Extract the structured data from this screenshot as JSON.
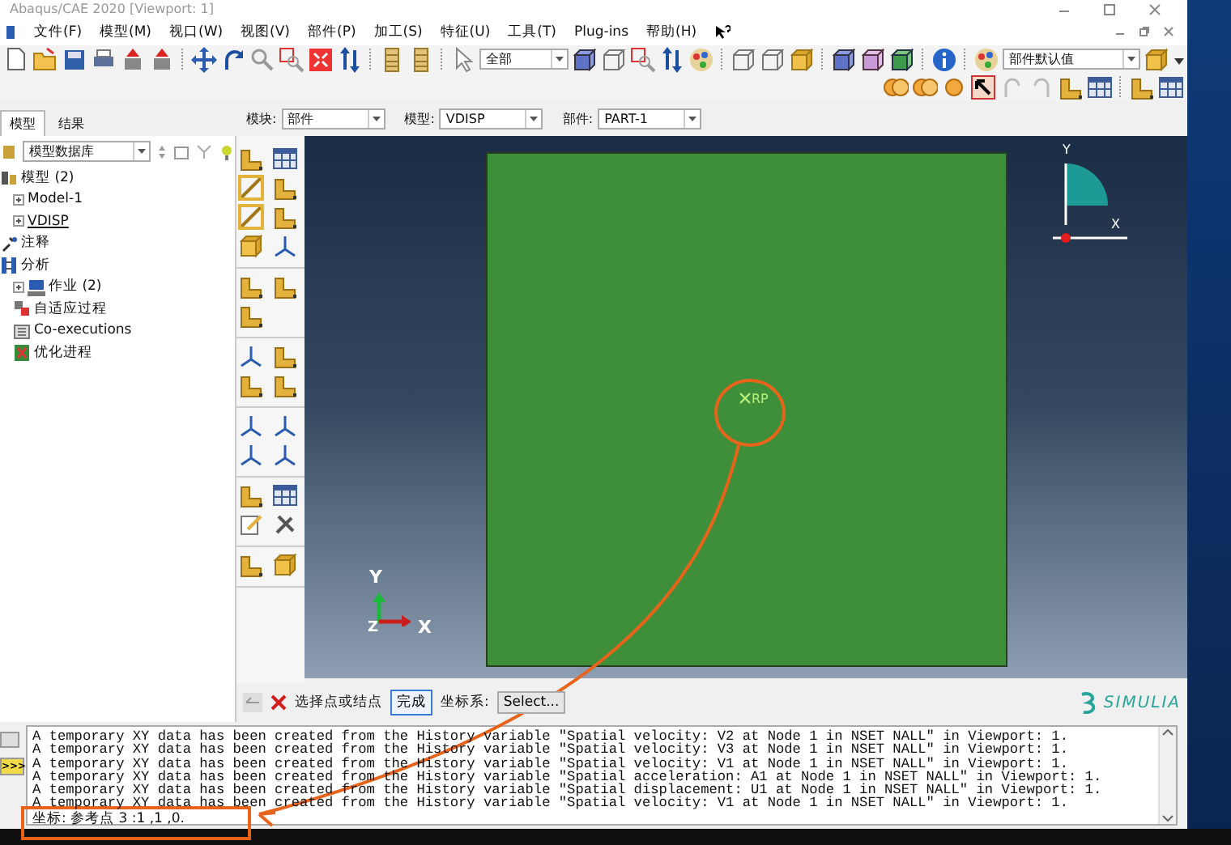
{
  "window": {
    "title": "Abaqus/CAE 2020 [Viewport: 1]"
  },
  "menu": [
    "文件(F)",
    "模型(M)",
    "视口(W)",
    "视图(V)",
    "部件(P)",
    "加工(S)",
    "特征(U)",
    "工具(T)",
    "Plug-ins",
    "帮助(H)"
  ],
  "toolbar": {
    "selection_filter": "全部",
    "part_defaults": "部件默认值"
  },
  "context_bar": [
    {
      "label": "模块:",
      "value": "部件"
    },
    {
      "label": "模型:",
      "value": "VDISP"
    },
    {
      "label": "部件:",
      "value": "PART-1"
    }
  ],
  "panel_tabs": [
    {
      "label": "模型",
      "selected": true
    },
    {
      "label": "结果",
      "selected": false
    }
  ],
  "tree": {
    "database": "模型数据库",
    "nodes": [
      {
        "label": "模型 (2)",
        "kind": "models",
        "collapsed": false,
        "current": false,
        "children": [
          {
            "label": "Model-1",
            "kind": "model",
            "collapsed": true,
            "current": false
          },
          {
            "label": "VDISP",
            "kind": "model",
            "collapsed": true,
            "current": true
          }
        ]
      },
      {
        "label": "注释",
        "kind": "annotations",
        "collapsed": false,
        "current": false
      },
      {
        "label": "分析",
        "kind": "analysis",
        "collapsed": false,
        "current": false,
        "children": [
          {
            "label": "作业 (2)",
            "kind": "jobs",
            "collapsed": true,
            "current": false
          },
          {
            "label": "自适应过程",
            "kind": "adaptivity",
            "collapsed": false,
            "current": false
          },
          {
            "label": "Co-executions",
            "kind": "coexec",
            "collapsed": false,
            "current": false
          },
          {
            "label": "优化进程",
            "kind": "optimization",
            "collapsed": false,
            "current": false
          }
        ]
      }
    ]
  },
  "viewport": {
    "point_label": "RP",
    "triad": {
      "y": "Y",
      "x": "X"
    },
    "axes": {
      "y": "Y",
      "z": "Z",
      "x": "X"
    }
  },
  "prompt": {
    "text": "选择点或结点",
    "done": "完成",
    "csys_label": "坐标系:",
    "csys_button": "Select..."
  },
  "brand": "SIMULIA",
  "command_toggle": ">>>",
  "messages": [
    "A temporary XY data has been created from the History variable \"Spatial velocity: V2 at Node 1 in NSET NALL\" in Viewport: 1.",
    "A temporary XY data has been created from the History variable \"Spatial velocity: V3 at Node 1 in NSET NALL\" in Viewport: 1.",
    "A temporary XY data has been created from the History variable \"Spatial velocity: V1 at Node 1 in NSET NALL\" in Viewport: 1.",
    "A temporary XY data has been created from the History variable \"Spatial acceleration: A1 at Node 1 in NSET NALL\" in Viewport: 1.",
    "A temporary XY data has been created from the History variable \"Spatial displacement: U1 at Node 1 in NSET NALL\" in Viewport: 1.",
    "A temporary XY data has been created from the History variable \"Spatial velocity: V1 at Node 1 in NSET NALL\" in Viewport: 1."
  ],
  "coordinate_line": "坐标:  参考点 3 :1 ,1 ,0."
}
